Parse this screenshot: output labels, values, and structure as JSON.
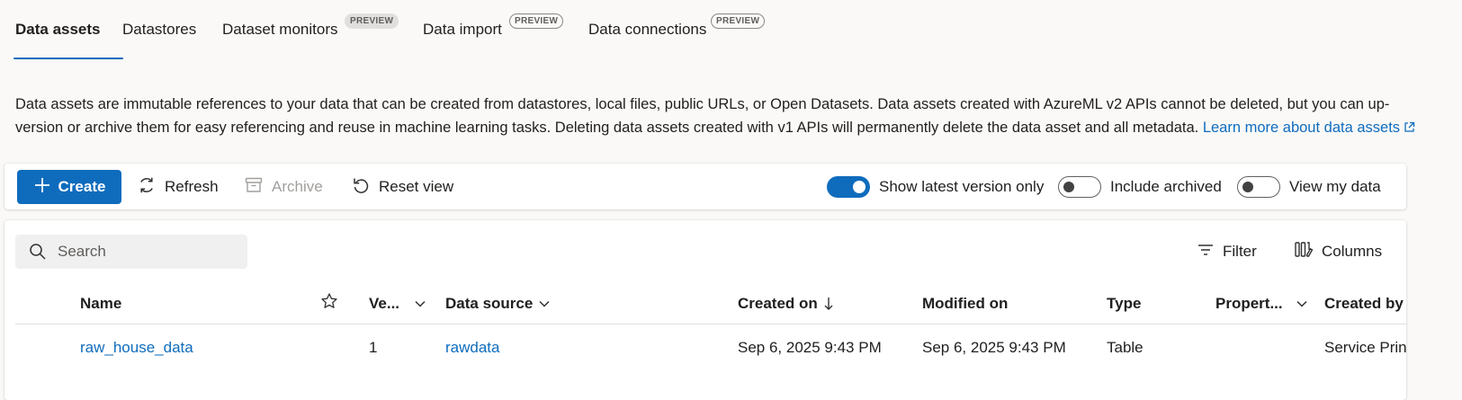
{
  "tabs": [
    {
      "label": "Data assets",
      "active": true,
      "badge": ""
    },
    {
      "label": "Datastores",
      "active": false,
      "badge": ""
    },
    {
      "label": "Dataset monitors",
      "active": false,
      "badge": "PREVIEW"
    },
    {
      "label": "Data import",
      "active": false,
      "badge": "PREVIEW"
    },
    {
      "label": "Data connections",
      "active": false,
      "badge": "PREVIEW"
    }
  ],
  "description": {
    "text": "Data assets are immutable references to your data that can be created from datastores, local files, public URLs, or Open Datasets. Data assets created with AzureML v2 APIs cannot be deleted, but you can up-version or archive them for easy referencing and reuse in machine learning tasks. Deleting data assets created with v1 APIs will permanently delete the data asset and all metadata. ",
    "link": "Learn more about data assets"
  },
  "toolbar": {
    "create": "Create",
    "refresh": "Refresh",
    "archive": "Archive",
    "reset_view": "Reset view",
    "show_latest": "Show latest version only",
    "include_archived": "Include archived",
    "view_my_data": "View my data"
  },
  "toggles": {
    "show_latest": true,
    "include_archived": false,
    "view_my_data": false
  },
  "grid": {
    "search_placeholder": "Search",
    "filter": "Filter",
    "columns": "Columns",
    "headers": {
      "name": "Name",
      "version": "Ve...",
      "data_source": "Data source",
      "created_on": "Created on",
      "modified_on": "Modified on",
      "type": "Type",
      "properties": "Propert...",
      "created_by": "Created by"
    },
    "rows": [
      {
        "name": "raw_house_data",
        "version": "1",
        "data_source": "rawdata",
        "created_on": "Sep 6, 2025 9:43 PM",
        "modified_on": "Sep 6, 2025 9:43 PM",
        "type": "Table",
        "properties": "",
        "created_by": "Service Princ"
      }
    ]
  },
  "colors": {
    "accent": "#0f6cbd",
    "disabled": "#a19f9d"
  },
  "icons": [
    "plus-icon",
    "refresh-icon",
    "archive-icon",
    "reset-icon",
    "search-icon",
    "filter-icon",
    "columns-icon",
    "star-icon",
    "chevron-down-icon",
    "sort-down-icon",
    "external-link-icon"
  ]
}
